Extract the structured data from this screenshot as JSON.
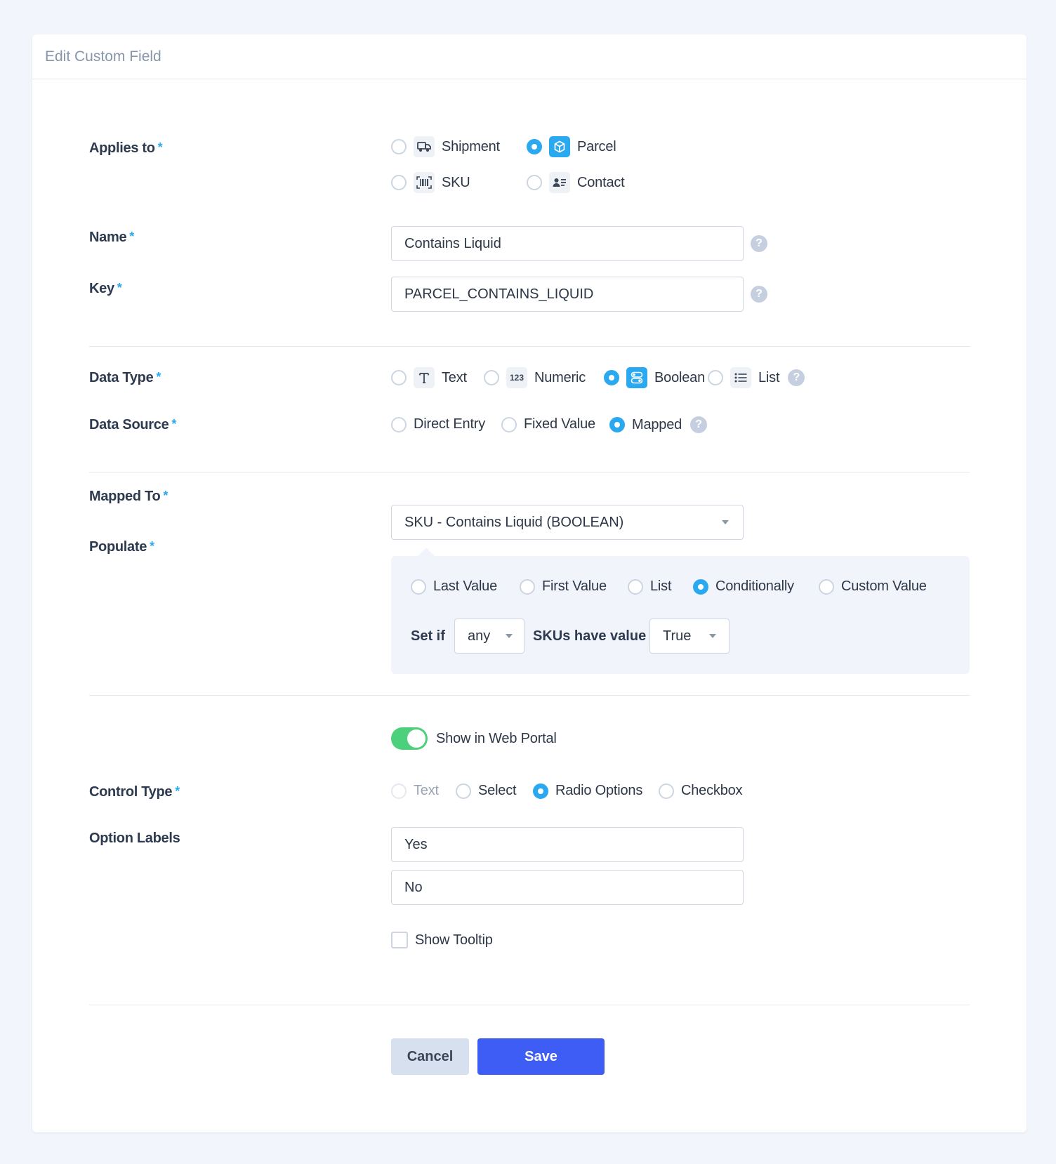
{
  "header": {
    "title": "Edit Custom Field"
  },
  "applies_to": {
    "label": "Applies to",
    "options": [
      {
        "label": "Shipment",
        "icon": "truck-icon",
        "selected": false
      },
      {
        "label": "Parcel",
        "icon": "box-icon",
        "selected": true
      },
      {
        "label": "SKU",
        "icon": "barcode-icon",
        "selected": false
      },
      {
        "label": "Contact",
        "icon": "contact-card-icon",
        "selected": false
      }
    ]
  },
  "name": {
    "label": "Name",
    "value": "Contains Liquid"
  },
  "key": {
    "label": "Key",
    "value": "PARCEL_CONTAINS_LIQUID"
  },
  "data_type": {
    "label": "Data Type",
    "options": [
      {
        "label": "Text",
        "icon": "text-icon",
        "selected": false
      },
      {
        "label": "Numeric",
        "icon": "numeric-icon",
        "icon_text": "123",
        "selected": false
      },
      {
        "label": "Boolean",
        "icon": "toggle-icon",
        "selected": true
      },
      {
        "label": "List",
        "icon": "list-icon",
        "selected": false
      }
    ]
  },
  "data_source": {
    "label": "Data Source",
    "options": [
      {
        "label": "Direct Entry",
        "selected": false
      },
      {
        "label": "Fixed Value",
        "selected": false
      },
      {
        "label": "Mapped",
        "selected": true
      }
    ]
  },
  "mapped_to": {
    "label": "Mapped To",
    "value": "SKU - Contains Liquid (BOOLEAN)"
  },
  "populate": {
    "label": "Populate",
    "options": [
      {
        "label": "Last Value",
        "selected": false
      },
      {
        "label": "First Value",
        "selected": false
      },
      {
        "label": "List",
        "selected": false
      },
      {
        "label": "Conditionally",
        "selected": true
      },
      {
        "label": "Custom Value",
        "selected": false
      }
    ],
    "set_if_label": "Set if",
    "quantifier": "any",
    "skus_have_value_label": "SKUs have value",
    "condition_value": "True"
  },
  "web_portal": {
    "label": "Show in Web Portal",
    "enabled": true
  },
  "control_type": {
    "label": "Control Type",
    "options": [
      {
        "label": "Text",
        "selected": false,
        "disabled": true
      },
      {
        "label": "Select",
        "selected": false
      },
      {
        "label": "Radio Options",
        "selected": true
      },
      {
        "label": "Checkbox",
        "selected": false
      }
    ]
  },
  "option_labels": {
    "label": "Option Labels",
    "values": [
      "Yes",
      "No"
    ]
  },
  "tooltip": {
    "label": "Show Tooltip",
    "checked": false
  },
  "actions": {
    "cancel": "Cancel",
    "save": "Save"
  },
  "colors": {
    "accent": "#2aa8f0",
    "primary_button": "#3d5df5",
    "toggle_on": "#4cd07c"
  }
}
